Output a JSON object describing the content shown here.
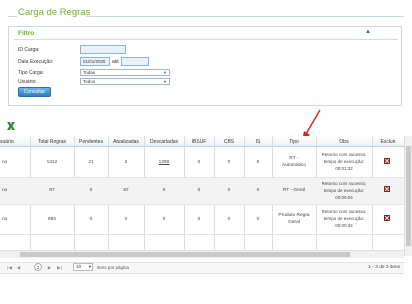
{
  "page": {
    "title": "Carga de Regras"
  },
  "filter": {
    "title": "Filtro",
    "collapse_icon": "caret-up-icon",
    "fields": {
      "id_carga": {
        "label": "ID Carga:",
        "value": ""
      },
      "data_execucao": {
        "label": "Data Execução:",
        "from": "01/01/2025",
        "sep": "até",
        "to": ""
      },
      "tipo_carga": {
        "label": "Tipo Carga:",
        "value": "Todas"
      },
      "usuario": {
        "label": "Usuário:",
        "value": "Todos"
      }
    },
    "submit_label": "Consultar"
  },
  "annotation": {
    "arrow_color": "#e02020"
  },
  "export_icon": "excel-icon",
  "grid": {
    "columns": [
      "suário",
      "Total Regras",
      "Pendentes",
      "Atualizadas",
      "Descartadas",
      "IBSUF",
      "CBS",
      "IS",
      "Tipo",
      "Obs",
      "Excluir"
    ],
    "rows": [
      {
        "usuario": "no",
        "total": "1312",
        "pendentes": "21",
        "atualizadas": "2",
        "descartadas": "1289",
        "ibsuf": "0",
        "cbs": "0",
        "is": "0",
        "tipo_l1": "RT -",
        "tipo_l2": "Automático",
        "obs_l1": "Retorno com sucesso,",
        "obs_l2": "tempo de execução:",
        "obs_l3": "00:01:32"
      },
      {
        "usuario": "no",
        "total": "87",
        "pendentes": "0",
        "atualizadas": "87",
        "descartadas": "0",
        "ibsuf": "0",
        "cbs": "0",
        "is": "0",
        "tipo_l1": "RT - Geral",
        "tipo_l2": "",
        "obs_l1": "Retorno com sucesso,",
        "obs_l2": "tempo de execução:",
        "obs_l3": "00:00:04"
      },
      {
        "usuario": "no",
        "total": "892",
        "pendentes": "0",
        "atualizadas": "0",
        "descartadas": "0",
        "ibsuf": "0",
        "cbs": "0",
        "is": "0",
        "tipo_l1": "Produto Regra",
        "tipo_l2": "Geral",
        "obs_l1": "Retorno com sucesso,",
        "obs_l2": "tempo de execução:",
        "obs_l3": "00:00:34"
      }
    ]
  },
  "pager": {
    "first": "|◀",
    "prev": "◀",
    "page": "1",
    "next": "▶",
    "last": "▶|",
    "page_size": "10",
    "page_size_caret": "▾",
    "items_label": "itens por página",
    "summary": "1 - 3 de 3 itens"
  }
}
